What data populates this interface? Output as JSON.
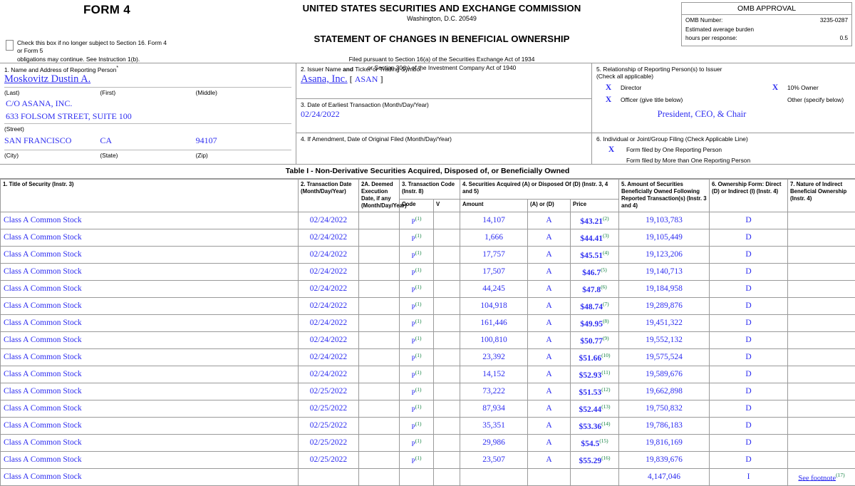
{
  "header": {
    "form_title": "FORM 4",
    "checkbox_note_line1": "Check this box if no longer subject to Section 16. Form 4 or Form 5",
    "checkbox_note_line2": "obligations may continue. See Instruction 1(b).",
    "agency_line1": "UNITED STATES SECURITIES AND EXCHANGE COMMISSION",
    "agency_line2": "Washington, D.C. 20549",
    "statement_title": "STATEMENT OF CHANGES IN BENEFICIAL OWNERSHIP",
    "filed_line1": "Filed pursuant to Section 16(a) of the Securities Exchange Act of 1934",
    "filed_line2": "or Section 30(h) of the Investment Company Act of 1940"
  },
  "omb": {
    "title": "OMB APPROVAL",
    "number_label": "OMB Number:",
    "number_value": "3235-0287",
    "burden_label_line1": "Estimated average burden",
    "burden_label_line2": "hours per response:",
    "burden_value": "0.5"
  },
  "box1": {
    "label": "1. Name and Address of Reporting Person",
    "reporting_person": "Moskovitz Dustin A.",
    "sub_last": "(Last)",
    "sub_first": "(First)",
    "sub_middle": "(Middle)",
    "street_line1": "C/O ASANA, INC.",
    "street_line2": "633 FOLSOM STREET, SUITE 100",
    "sub_street": "(Street)",
    "city": "SAN FRANCISCO",
    "state": "CA",
    "zip": "94107",
    "sub_city": "(City)",
    "sub_state": "(State)",
    "sub_zip": "(Zip)"
  },
  "box2": {
    "label_a": "2. Issuer Name ",
    "label_b": "and",
    "label_c": " Ticker or Trading Symbol",
    "issuer_name": "Asana, Inc.",
    "ticker_open": "[",
    "ticker": "ASAN",
    "ticker_close": "]"
  },
  "box3": {
    "label": "3. Date of Earliest Transaction (Month/Day/Year)",
    "value": "02/24/2022"
  },
  "box4": {
    "label": "4. If Amendment, Date of Original Filed (Month/Day/Year)",
    "value": ""
  },
  "box5": {
    "label_line1": "5. Relationship of Reporting Person(s) to Issuer",
    "label_line2": "(Check all applicable)",
    "director_mark": "X",
    "director_label": "Director",
    "tenpct_mark": "X",
    "tenpct_label": "10% Owner",
    "officer_mark": "X",
    "officer_label": "Officer (give title below)",
    "other_mark": "",
    "other_label": "Other (specify below)",
    "officer_title": "President, CEO, & Chair"
  },
  "box6": {
    "label": "6. Individual or Joint/Group Filing (Check Applicable Line)",
    "one_mark": "X",
    "one_label": "Form filed by One Reporting Person",
    "more_mark": "",
    "more_label": "Form filed by More than One Reporting Person"
  },
  "table1": {
    "title": "Table I - Non-Derivative Securities Acquired, Disposed of, or Beneficially Owned",
    "headers": {
      "c1": "1. Title of Security (Instr. 3)",
      "c2": "2. Transaction Date (Month/Day/Year)",
      "c2a": "2A. Deemed Execution Date, if any (Month/Day/Year)",
      "c3": "3. Transaction Code (Instr. 8)",
      "c3_code": "Code",
      "c3_v": "V",
      "c4": "4. Securities Acquired (A) or Disposed Of (D) (Instr. 3, 4 and 5)",
      "c4_amount": "Amount",
      "c4_ad": "(A) or (D)",
      "c4_price": "Price",
      "c5": "5. Amount of Securities Beneficially Owned Following Reported Transaction(s) (Instr. 3 and 4)",
      "c6": "6. Ownership Form: Direct (D) or Indirect (I) (Instr. 4)",
      "c7": "7. Nature of Indirect Beneficial Ownership (Instr. 4)"
    },
    "rows": [
      {
        "security": "Class A Common Stock",
        "date": "02/24/2022",
        "deemed": "",
        "code": "P",
        "code_fn": "1",
        "v": "",
        "amount": "14,107",
        "ad": "A",
        "price": "$43.21",
        "price_fn": "2",
        "owned": "19,103,783",
        "form": "D",
        "nature": "",
        "nature_fn": ""
      },
      {
        "security": "Class A Common Stock",
        "date": "02/24/2022",
        "deemed": "",
        "code": "P",
        "code_fn": "1",
        "v": "",
        "amount": "1,666",
        "ad": "A",
        "price": "$44.41",
        "price_fn": "3",
        "owned": "19,105,449",
        "form": "D",
        "nature": "",
        "nature_fn": ""
      },
      {
        "security": "Class A Common Stock",
        "date": "02/24/2022",
        "deemed": "",
        "code": "P",
        "code_fn": "1",
        "v": "",
        "amount": "17,757",
        "ad": "A",
        "price": "$45.51",
        "price_fn": "4",
        "owned": "19,123,206",
        "form": "D",
        "nature": "",
        "nature_fn": ""
      },
      {
        "security": "Class A Common Stock",
        "date": "02/24/2022",
        "deemed": "",
        "code": "P",
        "code_fn": "1",
        "v": "",
        "amount": "17,507",
        "ad": "A",
        "price": "$46.7",
        "price_fn": "5",
        "owned": "19,140,713",
        "form": "D",
        "nature": "",
        "nature_fn": ""
      },
      {
        "security": "Class A Common Stock",
        "date": "02/24/2022",
        "deemed": "",
        "code": "P",
        "code_fn": "1",
        "v": "",
        "amount": "44,245",
        "ad": "A",
        "price": "$47.8",
        "price_fn": "6",
        "owned": "19,184,958",
        "form": "D",
        "nature": "",
        "nature_fn": ""
      },
      {
        "security": "Class A Common Stock",
        "date": "02/24/2022",
        "deemed": "",
        "code": "P",
        "code_fn": "1",
        "v": "",
        "amount": "104,918",
        "ad": "A",
        "price": "$48.74",
        "price_fn": "7",
        "owned": "19,289,876",
        "form": "D",
        "nature": "",
        "nature_fn": ""
      },
      {
        "security": "Class A Common Stock",
        "date": "02/24/2022",
        "deemed": "",
        "code": "P",
        "code_fn": "1",
        "v": "",
        "amount": "161,446",
        "ad": "A",
        "price": "$49.95",
        "price_fn": "8",
        "owned": "19,451,322",
        "form": "D",
        "nature": "",
        "nature_fn": ""
      },
      {
        "security": "Class A Common Stock",
        "date": "02/24/2022",
        "deemed": "",
        "code": "P",
        "code_fn": "1",
        "v": "",
        "amount": "100,810",
        "ad": "A",
        "price": "$50.77",
        "price_fn": "9",
        "owned": "19,552,132",
        "form": "D",
        "nature": "",
        "nature_fn": ""
      },
      {
        "security": "Class A Common Stock",
        "date": "02/24/2022",
        "deemed": "",
        "code": "P",
        "code_fn": "1",
        "v": "",
        "amount": "23,392",
        "ad": "A",
        "price": "$51.66",
        "price_fn": "10",
        "owned": "19,575,524",
        "form": "D",
        "nature": "",
        "nature_fn": ""
      },
      {
        "security": "Class A Common Stock",
        "date": "02/24/2022",
        "deemed": "",
        "code": "P",
        "code_fn": "1",
        "v": "",
        "amount": "14,152",
        "ad": "A",
        "price": "$52.93",
        "price_fn": "11",
        "owned": "19,589,676",
        "form": "D",
        "nature": "",
        "nature_fn": ""
      },
      {
        "security": "Class A Common Stock",
        "date": "02/25/2022",
        "deemed": "",
        "code": "P",
        "code_fn": "1",
        "v": "",
        "amount": "73,222",
        "ad": "A",
        "price": "$51.53",
        "price_fn": "12",
        "owned": "19,662,898",
        "form": "D",
        "nature": "",
        "nature_fn": ""
      },
      {
        "security": "Class A Common Stock",
        "date": "02/25/2022",
        "deemed": "",
        "code": "P",
        "code_fn": "1",
        "v": "",
        "amount": "87,934",
        "ad": "A",
        "price": "$52.44",
        "price_fn": "13",
        "owned": "19,750,832",
        "form": "D",
        "nature": "",
        "nature_fn": ""
      },
      {
        "security": "Class A Common Stock",
        "date": "02/25/2022",
        "deemed": "",
        "code": "P",
        "code_fn": "1",
        "v": "",
        "amount": "35,351",
        "ad": "A",
        "price": "$53.36",
        "price_fn": "14",
        "owned": "19,786,183",
        "form": "D",
        "nature": "",
        "nature_fn": ""
      },
      {
        "security": "Class A Common Stock",
        "date": "02/25/2022",
        "deemed": "",
        "code": "P",
        "code_fn": "1",
        "v": "",
        "amount": "29,986",
        "ad": "A",
        "price": "$54.5",
        "price_fn": "15",
        "owned": "19,816,169",
        "form": "D",
        "nature": "",
        "nature_fn": ""
      },
      {
        "security": "Class A Common Stock",
        "date": "02/25/2022",
        "deemed": "",
        "code": "P",
        "code_fn": "1",
        "v": "",
        "amount": "23,507",
        "ad": "A",
        "price": "$55.29",
        "price_fn": "16",
        "owned": "19,839,676",
        "form": "D",
        "nature": "",
        "nature_fn": ""
      },
      {
        "security": "Class A Common Stock",
        "date": "",
        "deemed": "",
        "code": "",
        "code_fn": "",
        "v": "",
        "amount": "",
        "ad": "",
        "price": "",
        "price_fn": "",
        "owned": "4,147,046",
        "form": "I",
        "nature": "See footnote",
        "nature_fn": "17"
      }
    ]
  }
}
